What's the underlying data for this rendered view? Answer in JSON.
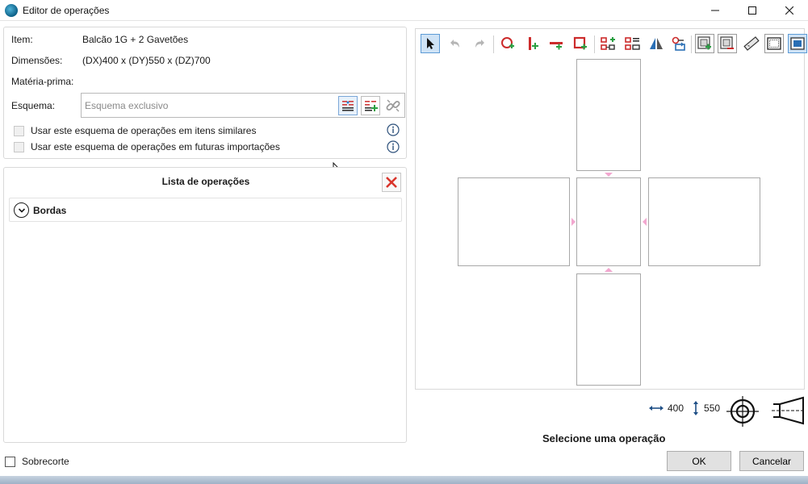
{
  "window": {
    "title": "Editor de operações"
  },
  "item": {
    "item_label": "Item:",
    "item_value": "Balcão 1G + 2 Gavetões",
    "dim_label": "Dimensões:",
    "dim_value": "(DX)400 x (DY)550 x (DZ)700",
    "material_label": "Matéria-prima:",
    "schema_label": "Esquema:",
    "schema_placeholder": "Esquema exclusivo",
    "check_similar": "Usar este esquema de operações em itens similares",
    "check_future": "Usar este esquema de operações em futuras importações"
  },
  "operations": {
    "title": "Lista de operações",
    "groups": [
      {
        "label": "Bordas"
      }
    ]
  },
  "footer": {
    "sobrecorte_label": "Sobrecorte",
    "ok_label": "OK",
    "cancel_label": "Cancelar"
  },
  "preview": {
    "dx": "400",
    "dy": "550",
    "status": "Selecione uma operação",
    "marker_color": "#f2a7cf"
  }
}
